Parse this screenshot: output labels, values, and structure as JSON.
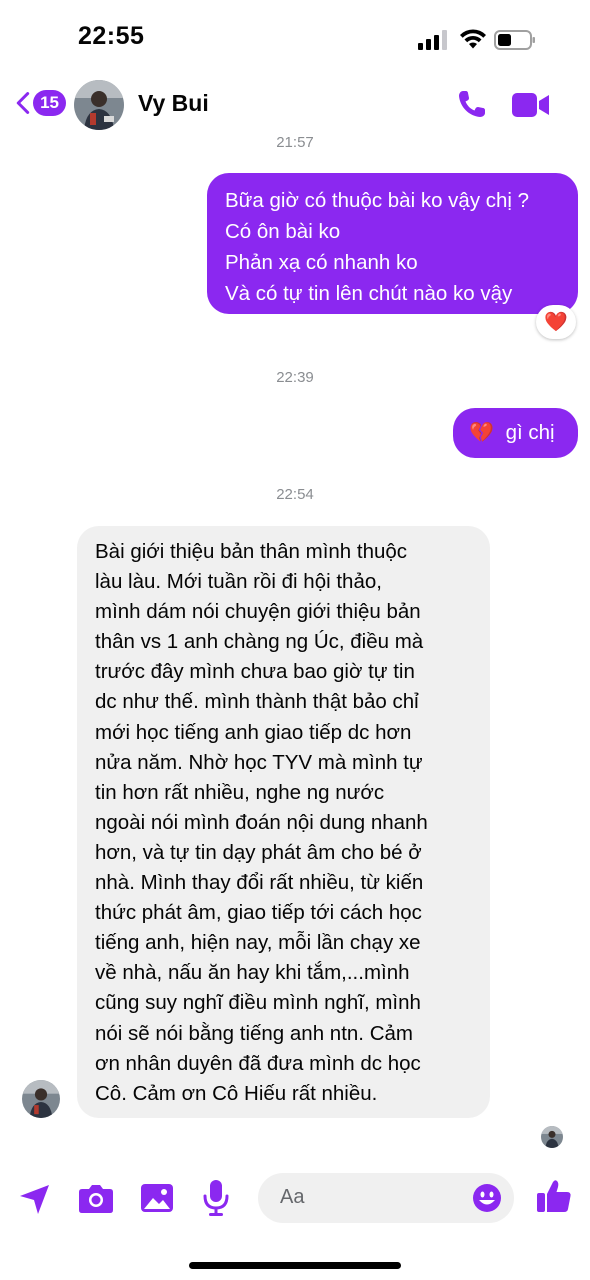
{
  "status_bar": {
    "time": "22:55"
  },
  "header": {
    "unread_count": "15",
    "contact_name": "Vy Bui"
  },
  "messages": {
    "ts1": "21:57",
    "out1_lines": [
      "Bữa giờ có thuộc bài ko vậy chị ?",
      "Có ôn bài ko",
      "Phản xạ có nhanh ko",
      "Và có tự tin lên chút nào ko vậy"
    ],
    "out1_reaction": "❤️",
    "ts2": "22:39",
    "out2_emoji": "💔",
    "out2_text": "gì chị",
    "ts3": "22:54",
    "in1_lines": [
      "Bài giới thiệu bản thân mình thuộc",
      "làu làu. Mới tuần rồi đi hội thảo,",
      "mình dám nói chuyện giới thiệu bản",
      "thân vs 1 anh chàng ng Úc, điều mà",
      "trước đây mình chưa bao giờ tự tin",
      "dc như thế. mình thành thật bảo chỉ",
      "mới học tiếng anh giao tiếp dc hơn",
      "nửa năm. Nhờ học TYV mà mình tự",
      "tin hơn rất nhiều, nghe ng nước",
      "ngoài nói mình đoán nội dung nhanh",
      "hơn, và tự tin dạy phát âm cho bé ở",
      "nhà. Mình thay đổi rất nhiều, từ kiến",
      "thức phát âm, giao tiếp tới cách học",
      "tiếng anh, hiện nay, mỗi lần chạy xe",
      "về nhà, nấu ăn hay khi tắm,...mình",
      "cũng suy nghĩ điều mình nghĩ, mình",
      "nói sẽ nói bằng tiếng anh ntn. Cảm",
      "ơn nhân duyên đã đưa mình dc học",
      "Cô. Cảm ơn Cô Hiếu rất nhiều."
    ]
  },
  "composer": {
    "placeholder": "Aa"
  },
  "colors": {
    "accent": "#8b28f0",
    "incoming_bubble": "#f0f0f0",
    "timestamp": "#8a8d91"
  },
  "icons": {
    "header": [
      "chevron-left-icon",
      "phone-icon",
      "video-camera-icon"
    ],
    "composer": [
      "send-location-icon",
      "camera-icon",
      "gallery-icon",
      "microphone-icon",
      "emoji-icon",
      "like-icon"
    ]
  }
}
